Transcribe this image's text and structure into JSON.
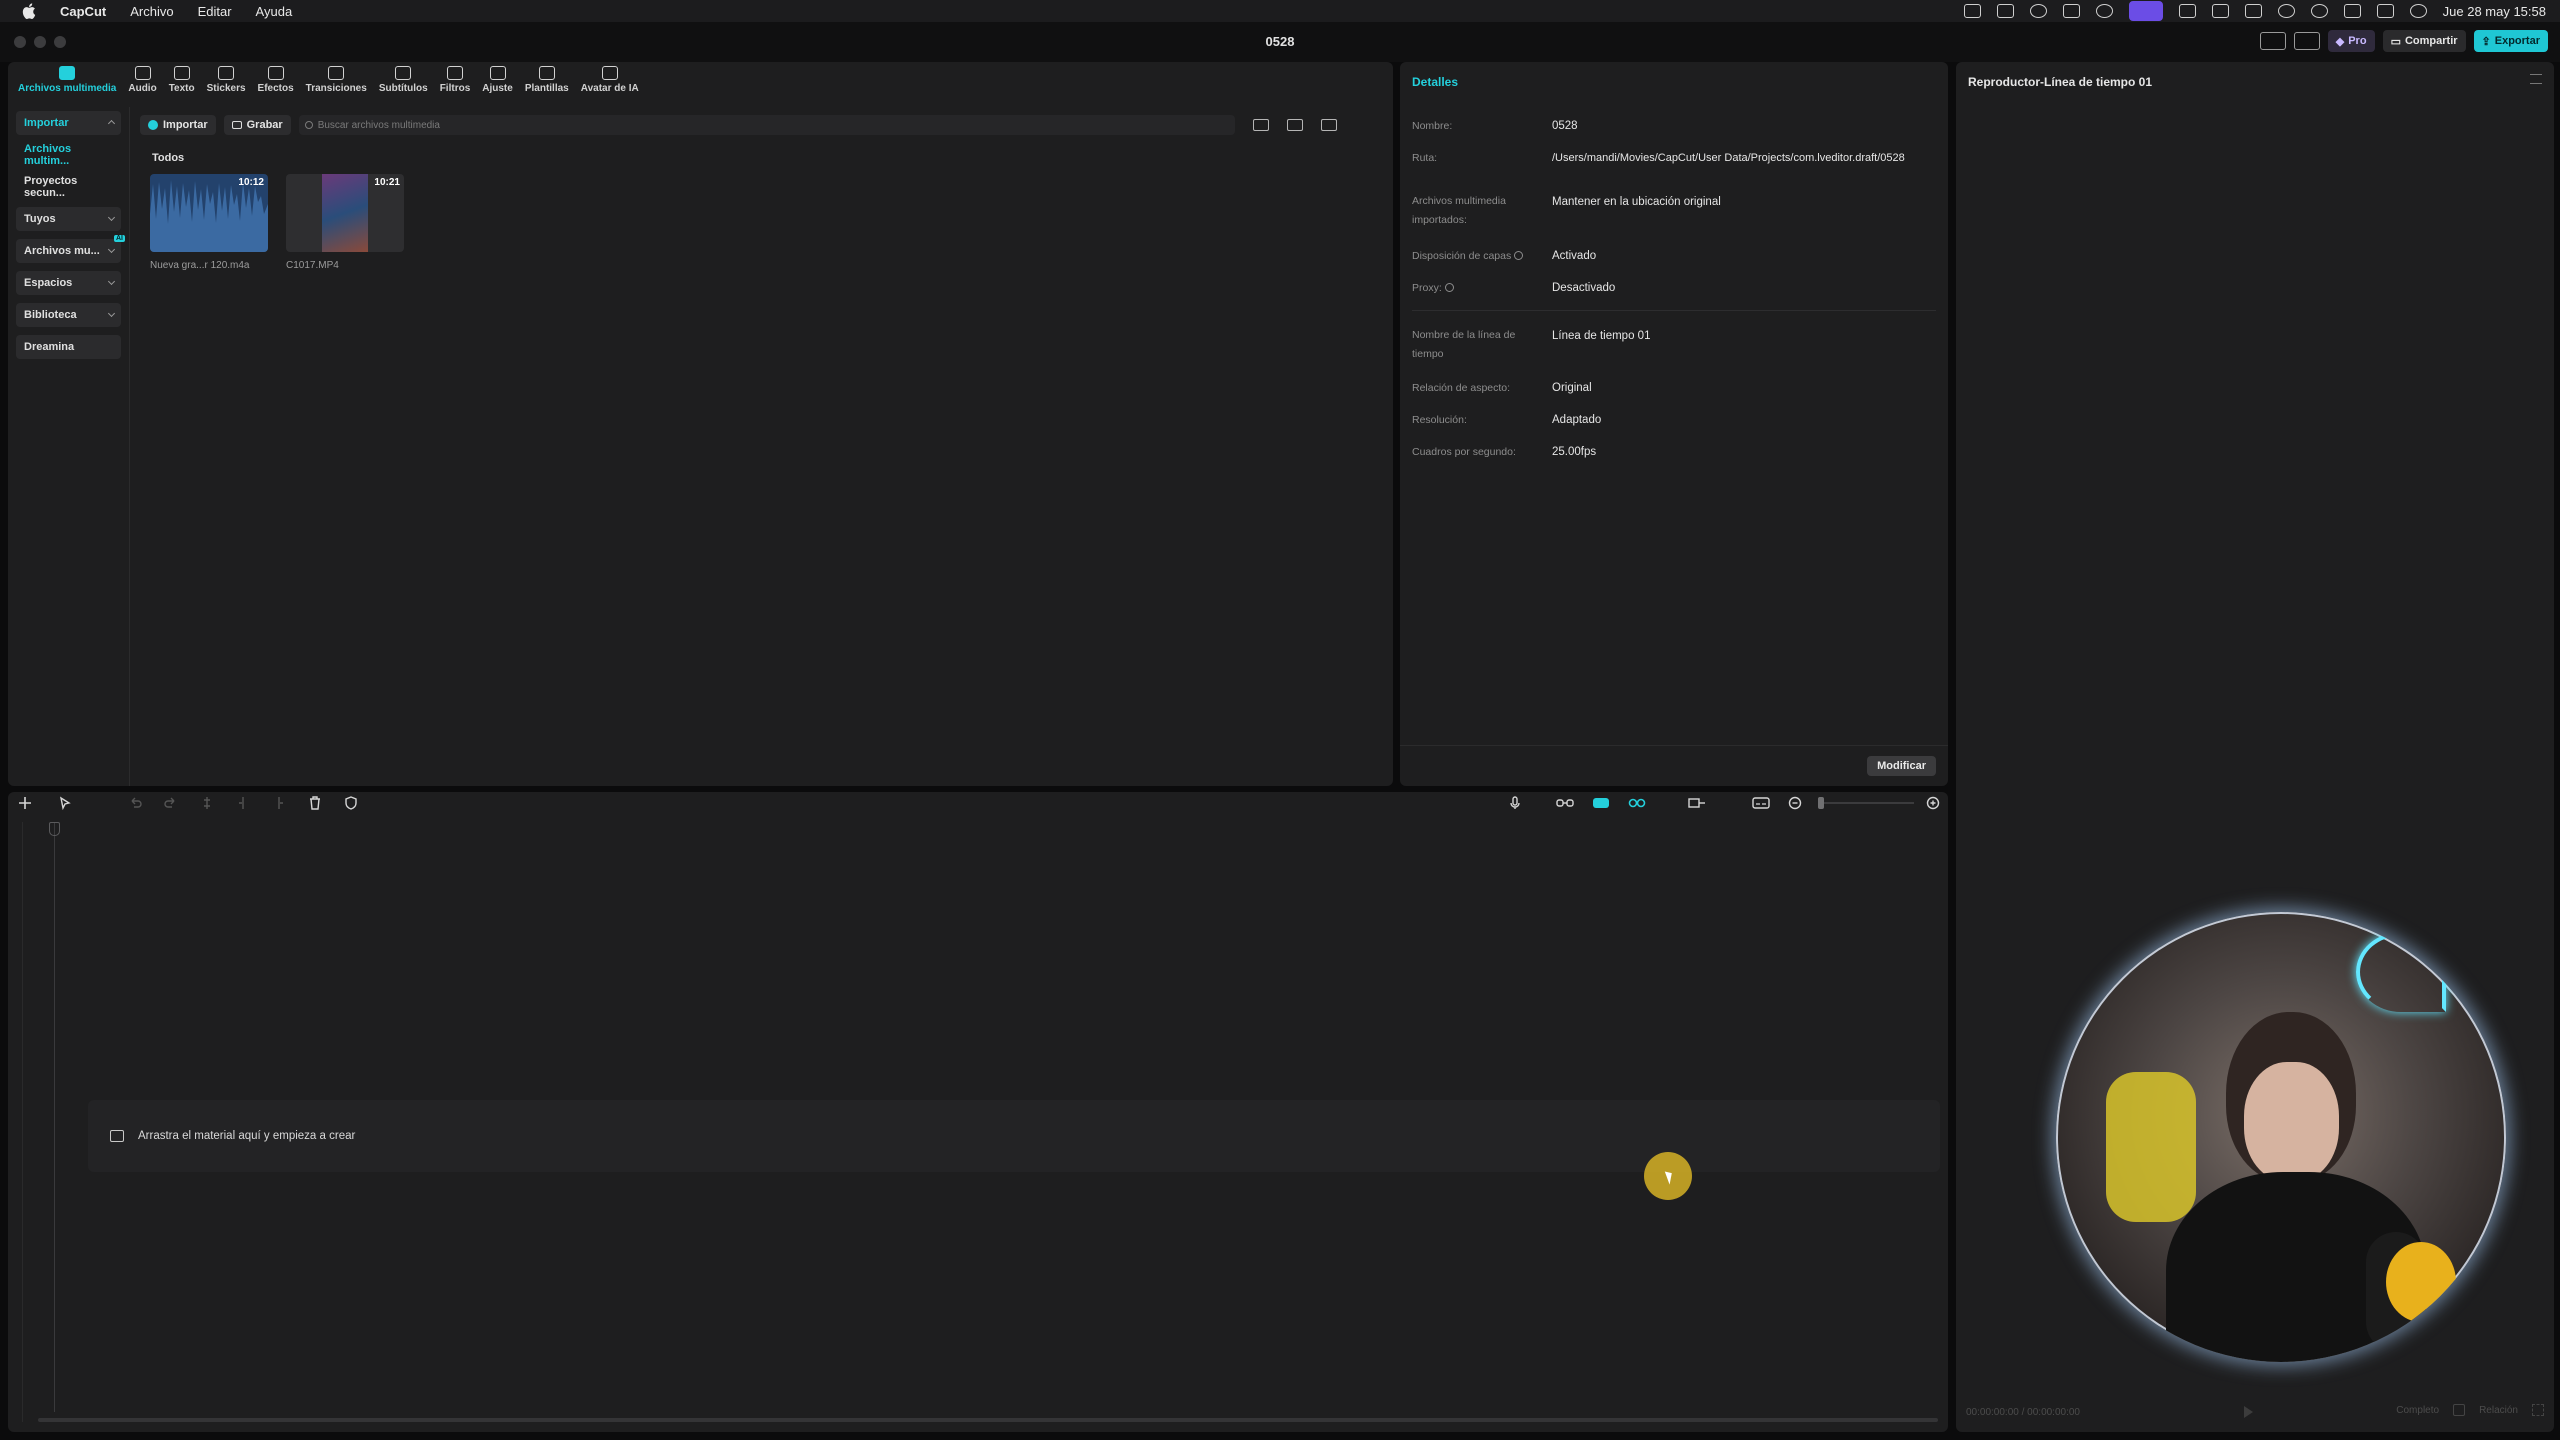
{
  "menubar": {
    "app_name": "CapCut",
    "menus": [
      "Archivo",
      "Editar",
      "Ayuda"
    ],
    "datetime": "Jue 28 may 15:58"
  },
  "window": {
    "title": "0528",
    "pro_label": "Pro",
    "share_label": "Compartir",
    "export_label": "Exportar"
  },
  "media_tabs": [
    {
      "label": "Archivos multimedia",
      "icon": "media-icon",
      "active": true
    },
    {
      "label": "Audio",
      "icon": "audio-icon"
    },
    {
      "label": "Texto",
      "icon": "text-icon"
    },
    {
      "label": "Stickers",
      "icon": "sticker-icon"
    },
    {
      "label": "Efectos",
      "icon": "effects-icon"
    },
    {
      "label": "Transiciones",
      "icon": "transitions-icon"
    },
    {
      "label": "Subtítulos",
      "icon": "subtitles-icon"
    },
    {
      "label": "Filtros",
      "icon": "filters-icon"
    },
    {
      "label": "Ajuste",
      "icon": "adjust-icon"
    },
    {
      "label": "Plantillas",
      "icon": "templates-icon"
    },
    {
      "label": "Avatar de IA",
      "icon": "ai-avatar-icon"
    }
  ],
  "sidebar": {
    "items": [
      {
        "label": "Importar",
        "style": "accent",
        "chevron": "up"
      },
      {
        "label": "Archivos multim...",
        "style": "sub"
      },
      {
        "label": "Proyectos secun...",
        "style": "plain"
      },
      {
        "label": "Tuyos",
        "style": "normal",
        "chevron": "down"
      },
      {
        "label": "Archivos mu...",
        "style": "normal",
        "chevron": "down",
        "badge": "AI"
      },
      {
        "label": "Espacios",
        "style": "normal",
        "chevron": "down"
      },
      {
        "label": "Biblioteca",
        "style": "normal",
        "chevron": "down"
      },
      {
        "label": "Dreamina",
        "style": "normal"
      }
    ]
  },
  "media": {
    "import_label": "Importar",
    "record_label": "Grabar",
    "search_placeholder": "Buscar archivos multimedia",
    "section_label": "Todos",
    "items": [
      {
        "name": "Nueva gra...r 120.m4a",
        "duration": "10:12",
        "type": "audio"
      },
      {
        "name": "C1017.MP4",
        "duration": "10:21",
        "type": "video"
      }
    ]
  },
  "details": {
    "title": "Detalles",
    "rows": [
      {
        "label": "Nombre:",
        "value": "0528"
      },
      {
        "label": "Ruta:",
        "value": "/Users/mandi/Movies/CapCut/User Data/Projects/com.lveditor.draft/0528"
      },
      {
        "label": "Archivos multimedia importados:",
        "value": "Mantener en la ubicación original"
      },
      {
        "label": "Disposición de capas",
        "value": "Activado",
        "help": true
      },
      {
        "label": "Proxy:",
        "value": "Desactivado",
        "help": true
      },
      {
        "label": "Nombre de la línea de tiempo",
        "value": "Línea de tiempo 01"
      },
      {
        "label": "Relación de aspecto:",
        "value": "Original"
      },
      {
        "label": "Resolución:",
        "value": "Adaptado"
      },
      {
        "label": "Cuadros por segundo:",
        "value": "25.00fps"
      }
    ],
    "modify_label": "Modificar"
  },
  "player": {
    "title": "Reproductor-Línea de tiempo 01",
    "timecode": "00:00:00:00 / 00:00:00:00",
    "full_label": "Completo",
    "ratio_label": "Relación"
  },
  "timeline": {
    "drop_hint": "Arrastra el material aquí y empieza a crear"
  },
  "colors": {
    "accent": "#24d0dc",
    "panel": "#1e1e1f",
    "background": "#0b0b0c"
  }
}
